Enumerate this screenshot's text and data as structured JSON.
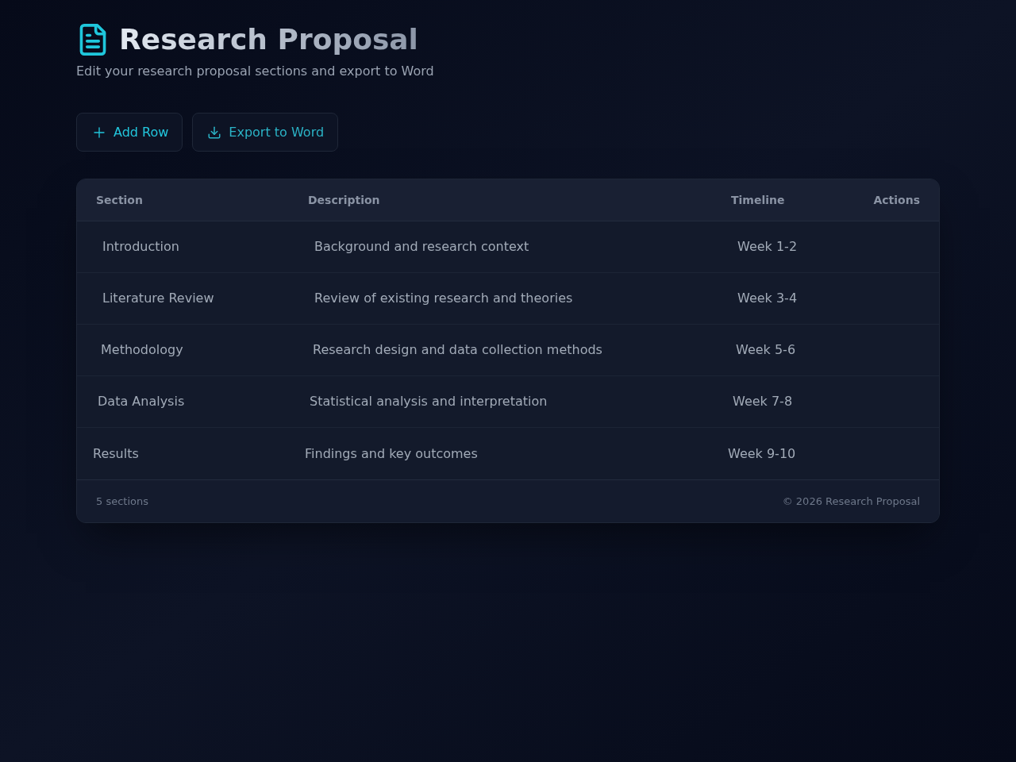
{
  "header": {
    "title": "Research Proposal",
    "subtitle": "Edit your research proposal sections and export to Word"
  },
  "toolbar": {
    "buttons": [
      {
        "label": "Add Row",
        "kind": "add"
      },
      {
        "label": "Export to Word",
        "kind": "export"
      }
    ]
  },
  "table": {
    "columns": [
      "Section",
      "Description",
      "Timeline",
      "Actions"
    ],
    "rows": [
      {
        "section": "Introduction",
        "description": "Background and research context",
        "timeline": "Week 1-2"
      },
      {
        "section": "Literature Review",
        "description": "Review of existing research and theories",
        "timeline": "Week 3-4"
      },
      {
        "section": "Methodology",
        "description": "Research design and data collection methods",
        "timeline": "Week 5-6"
      },
      {
        "section": "Data Analysis",
        "description": "Statistical analysis and interpretation",
        "timeline": "Week 7-8"
      },
      {
        "section": "Results",
        "description": "Findings and key outcomes",
        "timeline": "Week 9-10"
      }
    ]
  },
  "footer": {
    "count": "5 sections",
    "copyright": "© 2026 Research Proposal"
  }
}
